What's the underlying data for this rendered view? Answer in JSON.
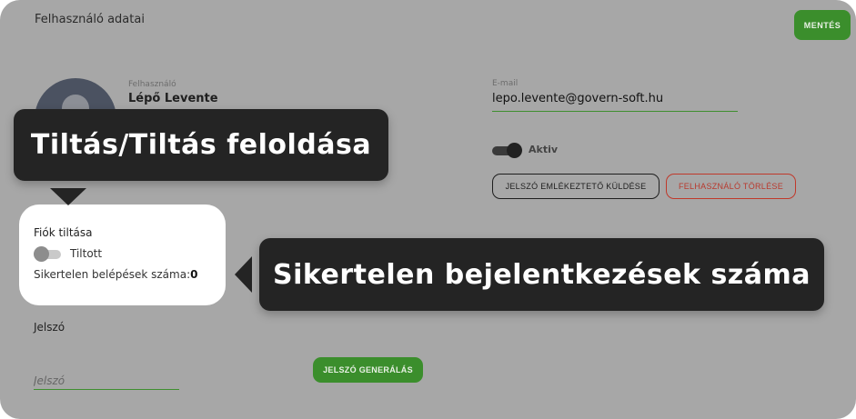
{
  "section": {
    "title": "Felhasználó adatai"
  },
  "toolbar": {
    "save_label": "MENTÉS"
  },
  "user": {
    "username_label": "Felhasználó",
    "username_value": "Lépő Levente",
    "email_label": "E-mail",
    "email_value": "lepo.levente@govern-soft.hu",
    "active_label": "Aktiv",
    "active_on": true
  },
  "actions": {
    "reminder_label": "JELSZÓ EMLÉKEZTETŐ KÜLDÉSE",
    "delete_label": "FELHASZNÁLÓ TÖRLÉSE"
  },
  "account_lock": {
    "title": "Fiók tiltása",
    "toggle_label": "Tiltott",
    "failed_logins_label": "Sikertelen belépések száma:",
    "failed_logins_value": "0"
  },
  "password": {
    "section_label": "Jelszó",
    "placeholder": "Jelszó",
    "generate_label": "JELSZÓ GENERÁLÁS"
  },
  "tooltips": {
    "lock_tooltip": "Tiltás/Tiltás feloldása",
    "failed_tooltip": "Sikertelen bejelentkezések száma"
  },
  "colors": {
    "accent_green": "#3b8e2c",
    "danger_red": "#c0392b",
    "tooltip_bg": "#242424",
    "overlay_gray": "#a7a7a7"
  }
}
